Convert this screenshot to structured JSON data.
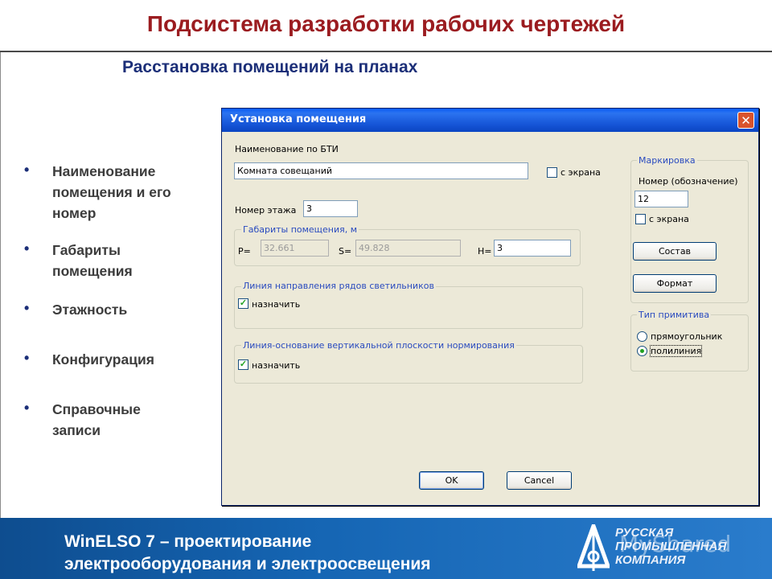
{
  "slide": {
    "title": "Подсистема разработки рабочих чертежей",
    "subtitle": "Расстановка помещений на планах",
    "bullets": [
      {
        "lines": [
          "Наименование",
          "помещения и его",
          "номер"
        ]
      },
      {
        "lines": [
          "Габариты",
          "помещения"
        ]
      },
      {
        "lines": [
          "Этажность"
        ]
      },
      {
        "lines": [
          "Конфигурация"
        ]
      },
      {
        "lines": [
          "Справочные",
          "записи"
        ]
      }
    ]
  },
  "dialog": {
    "title": "Установка помещения",
    "close_symbol": "✕",
    "name_label": "Наименование по БТИ",
    "name_value": "Комната совещаний",
    "from_screen_label": "с экрана",
    "floor_label": "Номер этажа",
    "floor_value": "3",
    "dims_group_label": "Габариты помещения, м",
    "p_label": "P=",
    "p_value": "32.661",
    "s_label": "S=",
    "s_value": "49.828",
    "h_label": "H=",
    "h_value": "3",
    "line_dir_group_label": "Линия направления рядов светильников",
    "assign1_label": "назначить",
    "assign1_checked": true,
    "line_base_group_label": "Линия-основание вертикальной плоскости нормирования",
    "assign2_label": "назначить",
    "assign2_checked": true,
    "marking": {
      "group_label": "Маркировка",
      "number_label": "Номер (обозначение)",
      "number_value": "12",
      "from_screen_label": "с экрана",
      "from_screen_checked": false,
      "composition_button": "Состав",
      "format_button": "Формат"
    },
    "primitive": {
      "group_label": "Тип примитива",
      "options": [
        {
          "label": "прямоугольник",
          "selected": false
        },
        {
          "label": "полилиния",
          "selected": true
        }
      ]
    },
    "ok_button": "OK",
    "cancel_button": "Cancel",
    "checkmark": "✓"
  },
  "footer": {
    "line1": "WinELSO 7 – проектирование",
    "line2": "электрооборудования и электроосвещения",
    "logo_lines": [
      "РУССКАЯ",
      "ПРОМЫШЛЕННАЯ",
      "КОМПАНИЯ"
    ],
    "watermark": "MyShared"
  },
  "colors": {
    "title": "#9b1c20",
    "subtitle": "#1c2f78",
    "footer_bg": "#1565b3",
    "titlebar": "#0a5cf5"
  }
}
